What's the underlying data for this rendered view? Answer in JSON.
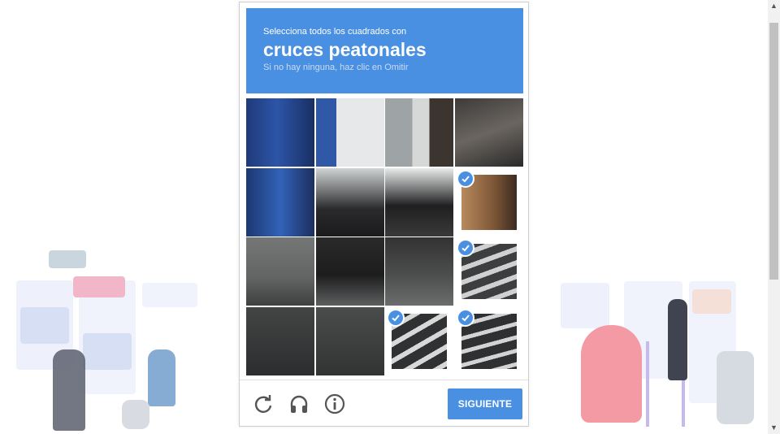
{
  "challenge": {
    "instruction": "Selecciona todos los cuadrados con",
    "target": "cruces peatonales",
    "hint": "Si no hay ninguna, haz clic en Omitir"
  },
  "tiles": [
    {
      "scene": "door-blue",
      "selected": false
    },
    {
      "scene": "wall-sign",
      "selected": false
    },
    {
      "scene": "wall-grey",
      "selected": false
    },
    {
      "scene": "shop-window",
      "selected": false
    },
    {
      "scene": "door-lower",
      "selected": false
    },
    {
      "scene": "scooter-top",
      "selected": false
    },
    {
      "scene": "scooter-mid",
      "selected": false
    },
    {
      "scene": "wood-door",
      "selected": true
    },
    {
      "scene": "street-left",
      "selected": false
    },
    {
      "scene": "scooter-wheel",
      "selected": false
    },
    {
      "scene": "scooter-wheel-r",
      "selected": false
    },
    {
      "scene": "crossing-1",
      "selected": true
    },
    {
      "scene": "road-dark",
      "selected": false
    },
    {
      "scene": "road-dark-2",
      "selected": false
    },
    {
      "scene": "crossing-2",
      "selected": true
    },
    {
      "scene": "crossing-3",
      "selected": true
    }
  ],
  "footer": {
    "submit_label": "SIGUIENTE",
    "icons": [
      "reload-icon",
      "audio-icon",
      "info-icon"
    ]
  },
  "colors": {
    "accent": "#4a90e2"
  }
}
